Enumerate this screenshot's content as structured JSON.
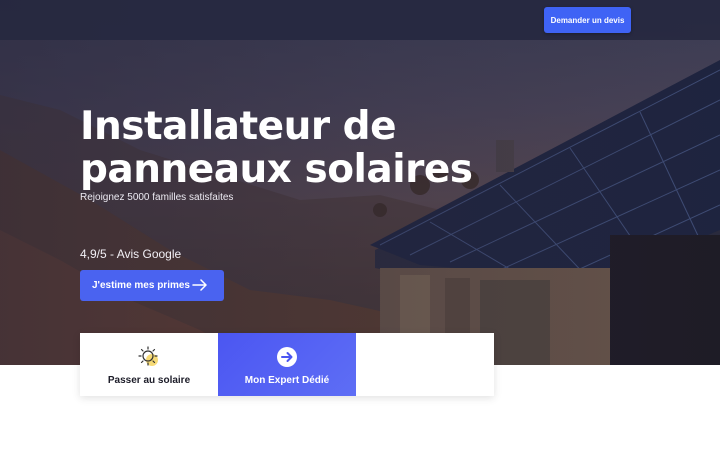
{
  "header": {
    "cta_label": "Demander un devis"
  },
  "hero": {
    "title": "Installateur de panneaux solaires",
    "subtitle": "Rejoignez 5000 familles satisfaites",
    "rating": "4,9/5 - Avis Google",
    "cta_label": "J'estime mes primes"
  },
  "cards": [
    {
      "label": "Passer au solaire",
      "icon": "sun-icon"
    },
    {
      "label": "Mon Expert Dédié",
      "icon": "arrow-circle-icon"
    },
    {
      "label": ""
    }
  ],
  "colors": {
    "accent": "#4a63f0",
    "topbar": "#262840",
    "text_dark": "#1c1c28"
  }
}
